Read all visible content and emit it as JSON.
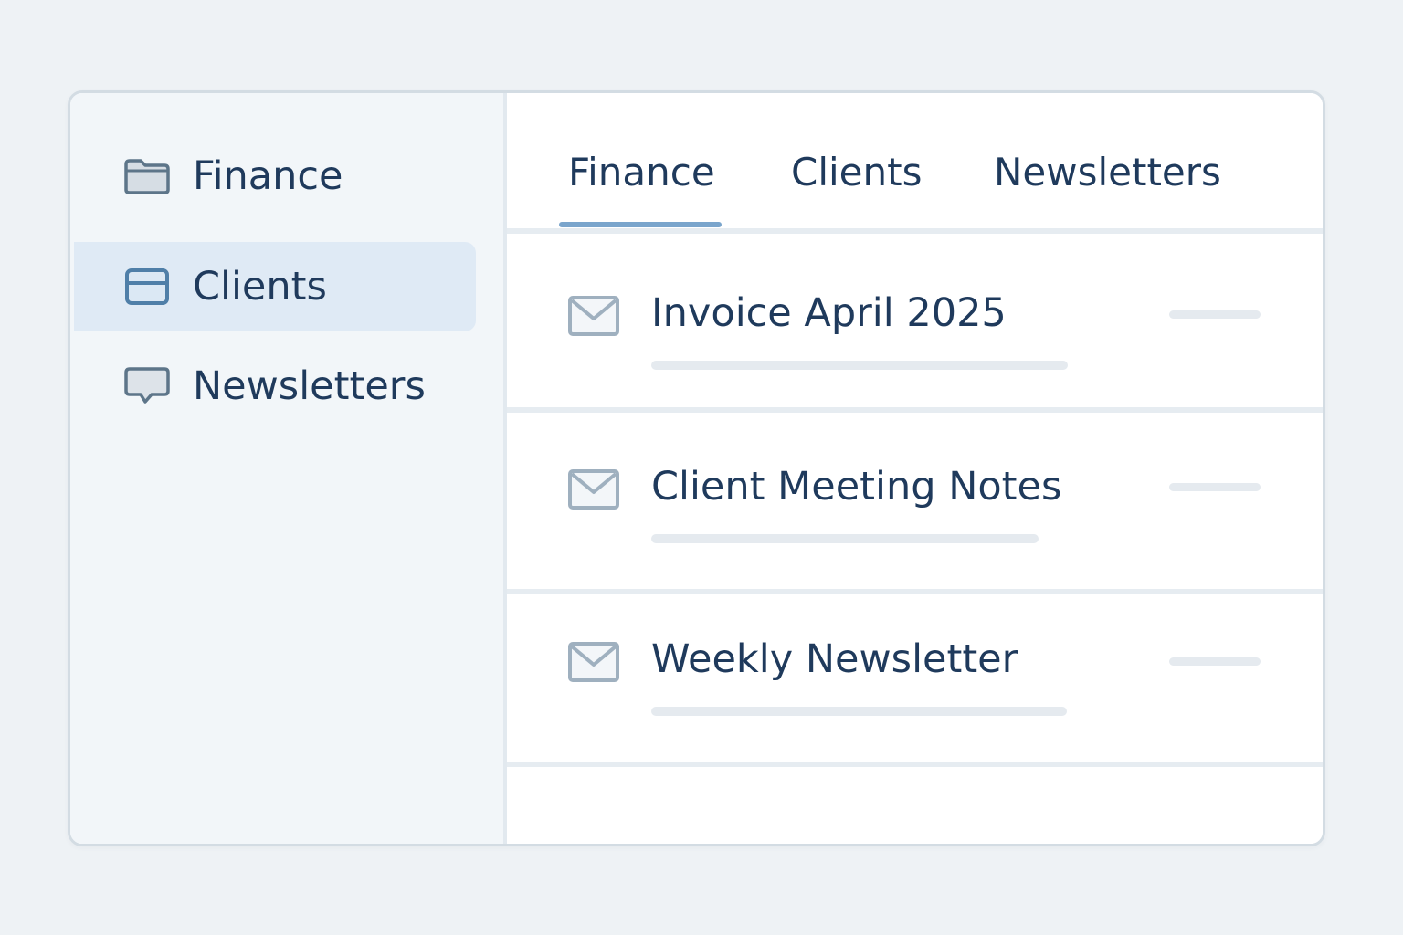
{
  "sidebar": {
    "items": [
      {
        "label": "Finance",
        "icon": "folder-icon",
        "active": false
      },
      {
        "label": "Clients",
        "icon": "card-icon",
        "active": true
      },
      {
        "label": "Newsletters",
        "icon": "chat-bubble-icon",
        "active": false
      }
    ]
  },
  "tabs": {
    "items": [
      {
        "label": "Finance",
        "active": true
      },
      {
        "label": "Clients",
        "active": false
      },
      {
        "label": "Newsletters",
        "active": false
      }
    ]
  },
  "messages": {
    "items": [
      {
        "subject": "Invoice April 2025",
        "icon": "mail-icon"
      },
      {
        "subject": "Client Meeting Notes",
        "icon": "mail-icon"
      },
      {
        "subject": "Weekly Newsletter",
        "icon": "mail-icon"
      }
    ]
  },
  "colors": {
    "page_background": "#eef2f5",
    "sidebar_background": "#f2f6f9",
    "active_item_background": "#dfeaf5",
    "text": "#1f3a5c",
    "accent": "#7aa5cc",
    "icon_active": "#4f7fa8",
    "icon_muted": "#9fb0bf"
  }
}
